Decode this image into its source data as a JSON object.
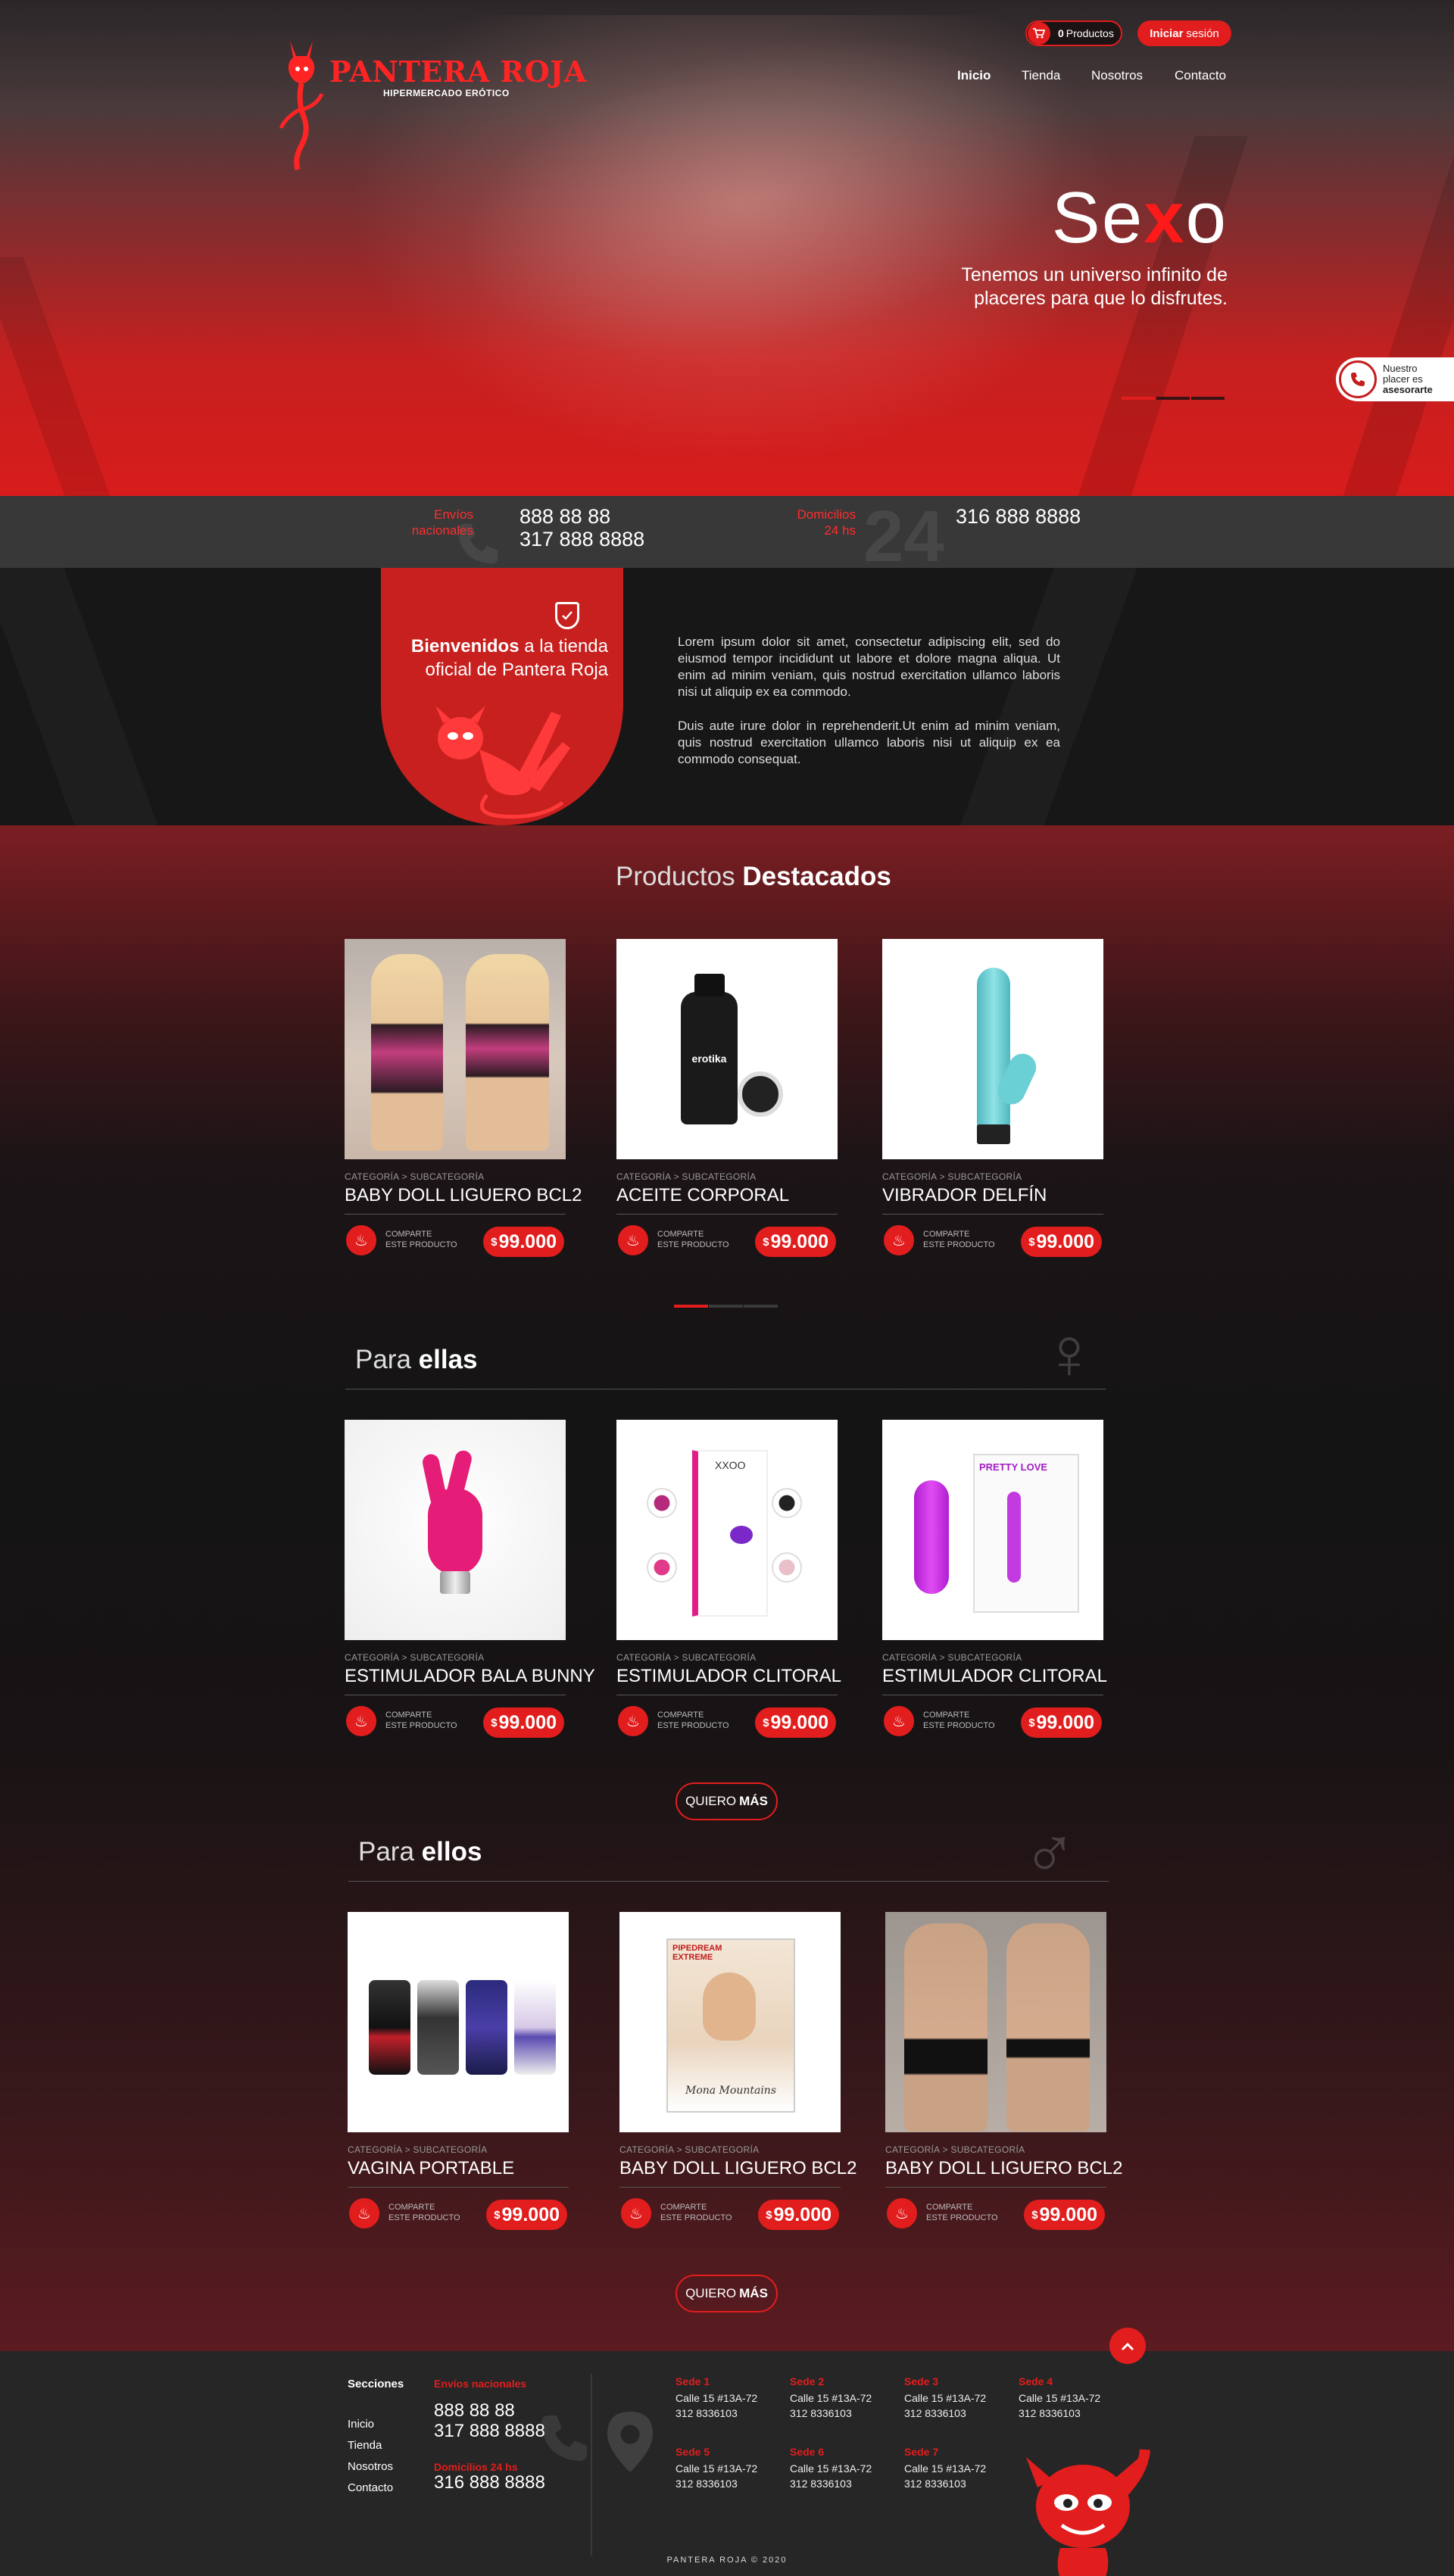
{
  "header": {
    "logo_title": "PANTERA ROJA",
    "logo_sub": "HIPERMERCADO ERÓTICO",
    "cart_count": "0",
    "cart_label": "Productos",
    "login_bold": "Iniciar",
    "login_rest": "sesión",
    "nav": [
      "Inicio",
      "Tienda",
      "Nosotros",
      "Contacto"
    ]
  },
  "hero": {
    "title_pre": "Se",
    "title_x": "x",
    "title_post": "o",
    "subtitle": "Tenemos un universo infinito de placeres para que lo disfrutes."
  },
  "advisor": {
    "line1": "Nuestro",
    "line2": "placer es",
    "line3": "asesorarte"
  },
  "infobar": {
    "envios_label_1": "Envíos",
    "envios_label_2": "nacionales",
    "envios_phone_1": "888 88 88",
    "envios_phone_2": "317 888 8888",
    "domicilios_label_1": "Domicilios",
    "domicilios_label_2": "24 hs",
    "domicilios_phone": "316 888 8888",
    "bg_24": "24"
  },
  "welcome": {
    "bold": "Bienvenidos",
    "rest_1": "a la tienda",
    "rest_2": "oficial de Pantera Roja",
    "para1": "Lorem ipsum dolor sit amet, consectetur adipiscing elit, sed do eiusmod tempor incididunt ut labore et dolore magna aliqua. Ut enim ad minim veniam, quis nostrud exercitation ullamco laboris nisi ut aliquip ex ea commodo.",
    "para2": "Duis aute irure dolor in reprehenderit.Ut enim ad minim veniam, quis nostrud exercitation ullamco laboris nisi ut aliquip ex ea commodo consequat."
  },
  "sections": {
    "featured": {
      "light": "Productos",
      "bold": "Destacados"
    },
    "ellas": {
      "light": "Para",
      "bold": "ellas"
    },
    "ellos": {
      "light": "Para",
      "bold": "ellos"
    },
    "more_light": "QUIERO",
    "more_bold": "MÁS"
  },
  "product_common": {
    "category": "CATEGORÍA > SUBCATEGORÍA",
    "share_1": "COMPARTE",
    "share_2": "ESTE PRODUCTO",
    "currency": "$"
  },
  "featured_products": [
    {
      "name": "BABY DOLL LIGUERO BCL2",
      "price": "99.000"
    },
    {
      "name": "ACEITE CORPORAL",
      "price": "99.000",
      "label": "erotika"
    },
    {
      "name": "VIBRADOR DELFÍN",
      "price": "99.000"
    }
  ],
  "ellas_products": [
    {
      "name": "ESTIMULADOR BALA BUNNY",
      "price": "99.000"
    },
    {
      "name": "ESTIMULADOR CLITORAL",
      "price": "99.000",
      "label": "XXOO"
    },
    {
      "name": "ESTIMULADOR CLITORAL",
      "price": "99.000",
      "label": "PRETTY LOVE"
    }
  ],
  "ellos_products": [
    {
      "name": "VAGINA PORTABLE",
      "price": "99.000"
    },
    {
      "name": "BABY DOLL LIGUERO BCL2",
      "price": "99.000",
      "label": "PIPEDREAM EXTREME",
      "label2": "Mona Mountains"
    },
    {
      "name": "BABY DOLL LIGUERO BCL2",
      "price": "99.000"
    }
  ],
  "footer": {
    "secciones_title": "Secciones",
    "links": [
      "Inicio",
      "Tienda",
      "Nosotros",
      "Contacto"
    ],
    "envios_title": "Envíos nacionales",
    "envios_1": "888 88 88",
    "envios_2": "317 888 8888",
    "domicilios_title": "Domicilios 24 hs",
    "domicilios": "316 888 8888",
    "sedes": [
      {
        "name": "Sede 1",
        "addr": "Calle 15 #13A-72",
        "phone": "312 8336103"
      },
      {
        "name": "Sede 2",
        "addr": "Calle 15 #13A-72",
        "phone": "312 8336103"
      },
      {
        "name": "Sede 3",
        "addr": "Calle 15 #13A-72",
        "phone": "312 8336103"
      },
      {
        "name": "Sede 4",
        "addr": "Calle 15 #13A-72",
        "phone": "312 8336103"
      },
      {
        "name": "Sede 5",
        "addr": "Calle 15 #13A-72",
        "phone": "312 8336103"
      },
      {
        "name": "Sede 6",
        "addr": "Calle 15 #13A-72",
        "phone": "312 8336103"
      },
      {
        "name": "Sede 7",
        "addr": "Calle 15 #13A-72",
        "phone": "312 8336103"
      }
    ],
    "copyright": "PANTERA ROJA © 2020"
  },
  "colors": {
    "brand_red": "#e21d1d",
    "dark": "#171717",
    "footer": "#262626"
  },
  "icons": [
    "cart-icon",
    "phone-icon",
    "shield-check-icon",
    "flame-icon",
    "female-symbol-icon",
    "male-symbol-icon",
    "location-pin-icon",
    "arrow-up-icon"
  ]
}
